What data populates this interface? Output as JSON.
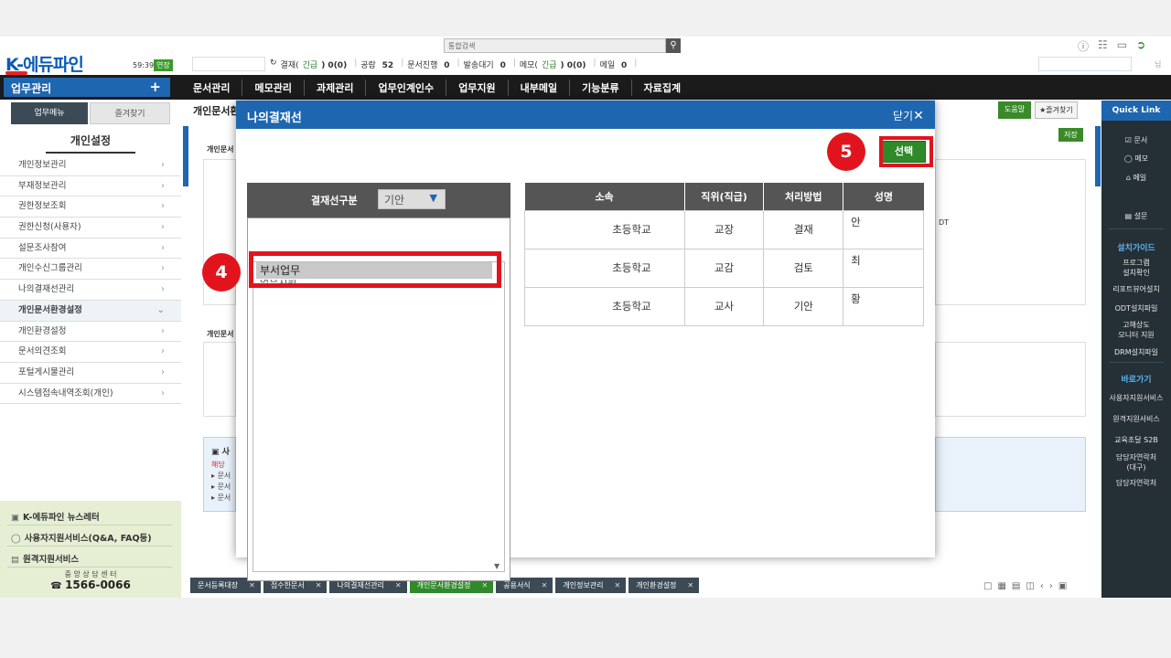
{
  "header": {
    "logo": "K-에듀파인",
    "clock": "59:39",
    "extend": "연장",
    "search_placeholder": "통합검색",
    "status": [
      {
        "label": "결재(",
        "urgent": "긴급",
        "tail": ") 0(0)"
      },
      {
        "label": "공람",
        "count": "52"
      },
      {
        "label": "문서진행",
        "count": "0"
      },
      {
        "label": "발송대기",
        "count": "0"
      },
      {
        "label": "메모(",
        "urgent": "긴급",
        "tail": ") 0(0)"
      },
      {
        "label": "메일",
        "count": "0"
      }
    ],
    "right_dot": "님"
  },
  "nav": {
    "left_label": "업무관리",
    "items": [
      "문서관리",
      "메모관리",
      "과제관리",
      "업무인계인수",
      "업무지원",
      "내부메일",
      "기능분류",
      "자료집계"
    ]
  },
  "sidebar": {
    "tab_menu": "업무메뉴",
    "tab_fav": "즐겨찾기",
    "title": "개인설정",
    "items": [
      "개인정보관리",
      "부재정보관리",
      "권한정보조회",
      "권한신청(사용자)",
      "설문조사참여",
      "개인수신그룹관리",
      "나의결재선관리",
      "개인문서환경설정",
      "개인환경설정",
      "문서의견조회",
      "포털게시물관리",
      "시스템접속내역조회(개인)"
    ],
    "bottom": {
      "newsletter": "K-에듀파인 뉴스레터",
      "support": "사용자지원서비스(Q&A, FAQ등)",
      "remote": "원격지원서비스",
      "center": "중 앙 상 담 센 터",
      "phone": "1566-0066"
    }
  },
  "main": {
    "title": "개인문서환",
    "help": "도움말",
    "fav": "★즐겨찾기",
    "save": "저장",
    "panel1_label": "개인문서",
    "panel2_label": "개인문서",
    "notice_title": "사",
    "notice_red": "해당",
    "notice_lines": [
      "문서",
      "문서",
      "문서"
    ],
    "right_snippet": "DT"
  },
  "bottom_tabs": [
    {
      "label": "문서등록대장",
      "active": false
    },
    {
      "label": "접수한문서",
      "active": false
    },
    {
      "label": "나의결재선관리",
      "active": false
    },
    {
      "label": "개인문서환경설정",
      "active": true
    },
    {
      "label": "공용서식",
      "active": false
    },
    {
      "label": "개인정보관리",
      "active": false
    },
    {
      "label": "개인환경설정",
      "active": false
    }
  ],
  "quick": {
    "head": "Quick Link",
    "links": [
      "문서",
      "메모",
      "메일",
      "설문"
    ],
    "install_head": "설치가이드",
    "install": [
      "프로그램\n설치확인",
      "리포트뷰어설치",
      "ODT설치파일",
      "고해상도\n모니터 지원",
      "DRM설치파일"
    ],
    "goto_head": "바로가기",
    "goto": [
      "사용자지원서비스",
      "원격지원서비스",
      "교육조달 S2B",
      "담당자연락처\n(대구)",
      "담당자연락처"
    ]
  },
  "modal": {
    "title": "나의결재선",
    "close": "닫기",
    "select_btn": "선택",
    "badge4": "4",
    "badge5": "5",
    "left": {
      "label": "결재선구분",
      "select_value": "기안",
      "selected_item": "부서업무",
      "next_item": "업무지원"
    },
    "table": {
      "headers": [
        "소속",
        "직위(직급)",
        "처리방법",
        "성명"
      ],
      "rows": [
        {
          "org": "초등학교",
          "position": "교장",
          "method": "결재",
          "name": "안"
        },
        {
          "org": "초등학교",
          "position": "교감",
          "method": "검토",
          "name": "최"
        },
        {
          "org": "초등학교",
          "position": "교사",
          "method": "기안",
          "name": "황"
        }
      ]
    }
  }
}
